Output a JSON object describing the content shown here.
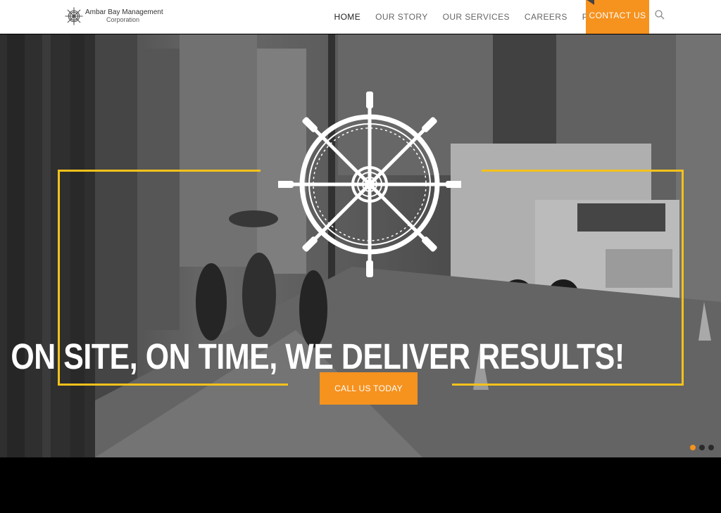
{
  "brand": {
    "name": "Ambar Bay Management",
    "sub": "Corporation"
  },
  "nav": {
    "items": [
      {
        "label": "HOME",
        "active": true
      },
      {
        "label": "OUR STORY"
      },
      {
        "label": "OUR SERVICES"
      },
      {
        "label": "CAREERS"
      },
      {
        "label": "PRICING"
      }
    ],
    "contact_label": "CONTACT US",
    "search_icon": "search-icon"
  },
  "hero": {
    "headline": "ON SITE, ON TIME, WE DELIVER RESULTS!",
    "cta_label": "CALL US TODAY",
    "emblem_icon": "ship-wheel-icon",
    "slides": 3,
    "active_slide": 1
  },
  "colors": {
    "accent": "#f6921e",
    "frame": "#f4c21b",
    "header_bg": "#ffffff"
  }
}
